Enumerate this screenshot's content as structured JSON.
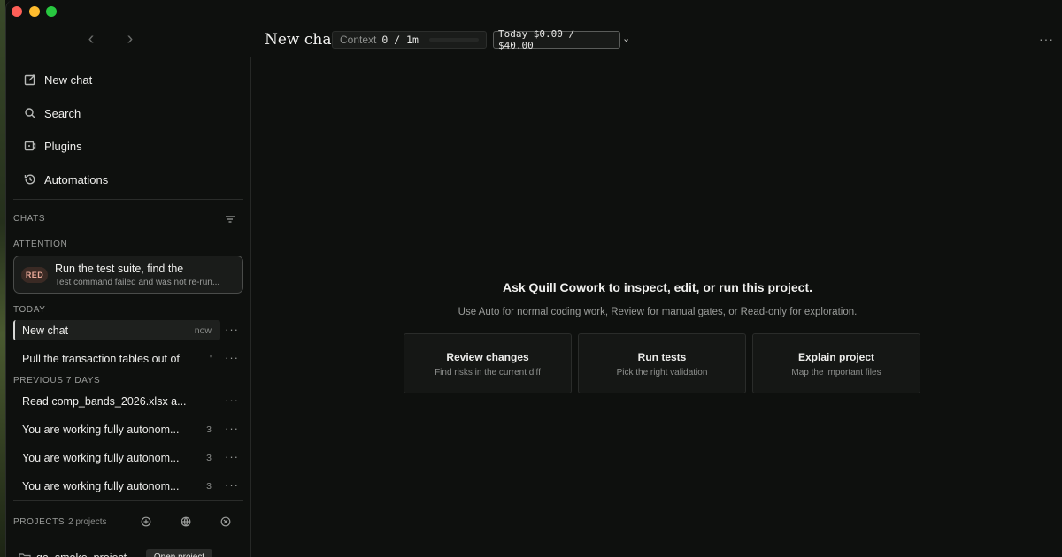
{
  "window": {
    "title": "New chat",
    "context": {
      "label": "Context",
      "value": "0 / 1m",
      "used_fraction": 0.0
    },
    "cost": {
      "text": "Today $0.00 / $40.00"
    }
  },
  "sidebar": {
    "nav": [
      {
        "label": "New chat",
        "icon": "compose-icon"
      },
      {
        "label": "Search",
        "icon": "search-icon"
      },
      {
        "label": "Plugins",
        "icon": "plugin-icon"
      },
      {
        "label": "Automations",
        "icon": "history-clock-icon"
      }
    ],
    "chats_label": "CHATS",
    "attention_label": "ATTENTION",
    "attention": {
      "badge": "RED",
      "title": "Run the test suite, find the",
      "subtitle": "Test command failed and was not re-run..."
    },
    "today_label": "TODAY",
    "today": [
      {
        "title": "New chat",
        "meta": "now",
        "active": true
      },
      {
        "title": "Pull the transaction tables out of",
        "meta": "'",
        "active": false
      }
    ],
    "prev_label": "PREVIOUS 7 DAYS",
    "previous": [
      {
        "title": "Read comp_bands_2026.xlsx a...",
        "meta": ""
      },
      {
        "title": "You are working fully autonom...",
        "meta": "3"
      },
      {
        "title": "You are working fully autonom...",
        "meta": "3"
      },
      {
        "title": "You are working fully autonom...",
        "meta": "3"
      }
    ],
    "projects_label": "PROJECTS",
    "projects_count": "2 projects",
    "project_row": {
      "name": "qa_smoke_project",
      "open_label": "Open project"
    }
  },
  "main": {
    "title": "Ask Quill Cowork to inspect, edit, or run this project.",
    "subtitle": "Use Auto for normal coding work, Review for manual gates, or Read-only for exploration.",
    "cards": [
      {
        "title": "Review changes",
        "subtitle": "Find risks in the current diff"
      },
      {
        "title": "Run tests",
        "subtitle": "Pick the right validation"
      },
      {
        "title": "Explain project",
        "subtitle": "Map the important files"
      }
    ]
  },
  "colors": {
    "background": "#0e100e",
    "accent_border": "#5a5c5a",
    "badge_red": "#e8a898"
  }
}
